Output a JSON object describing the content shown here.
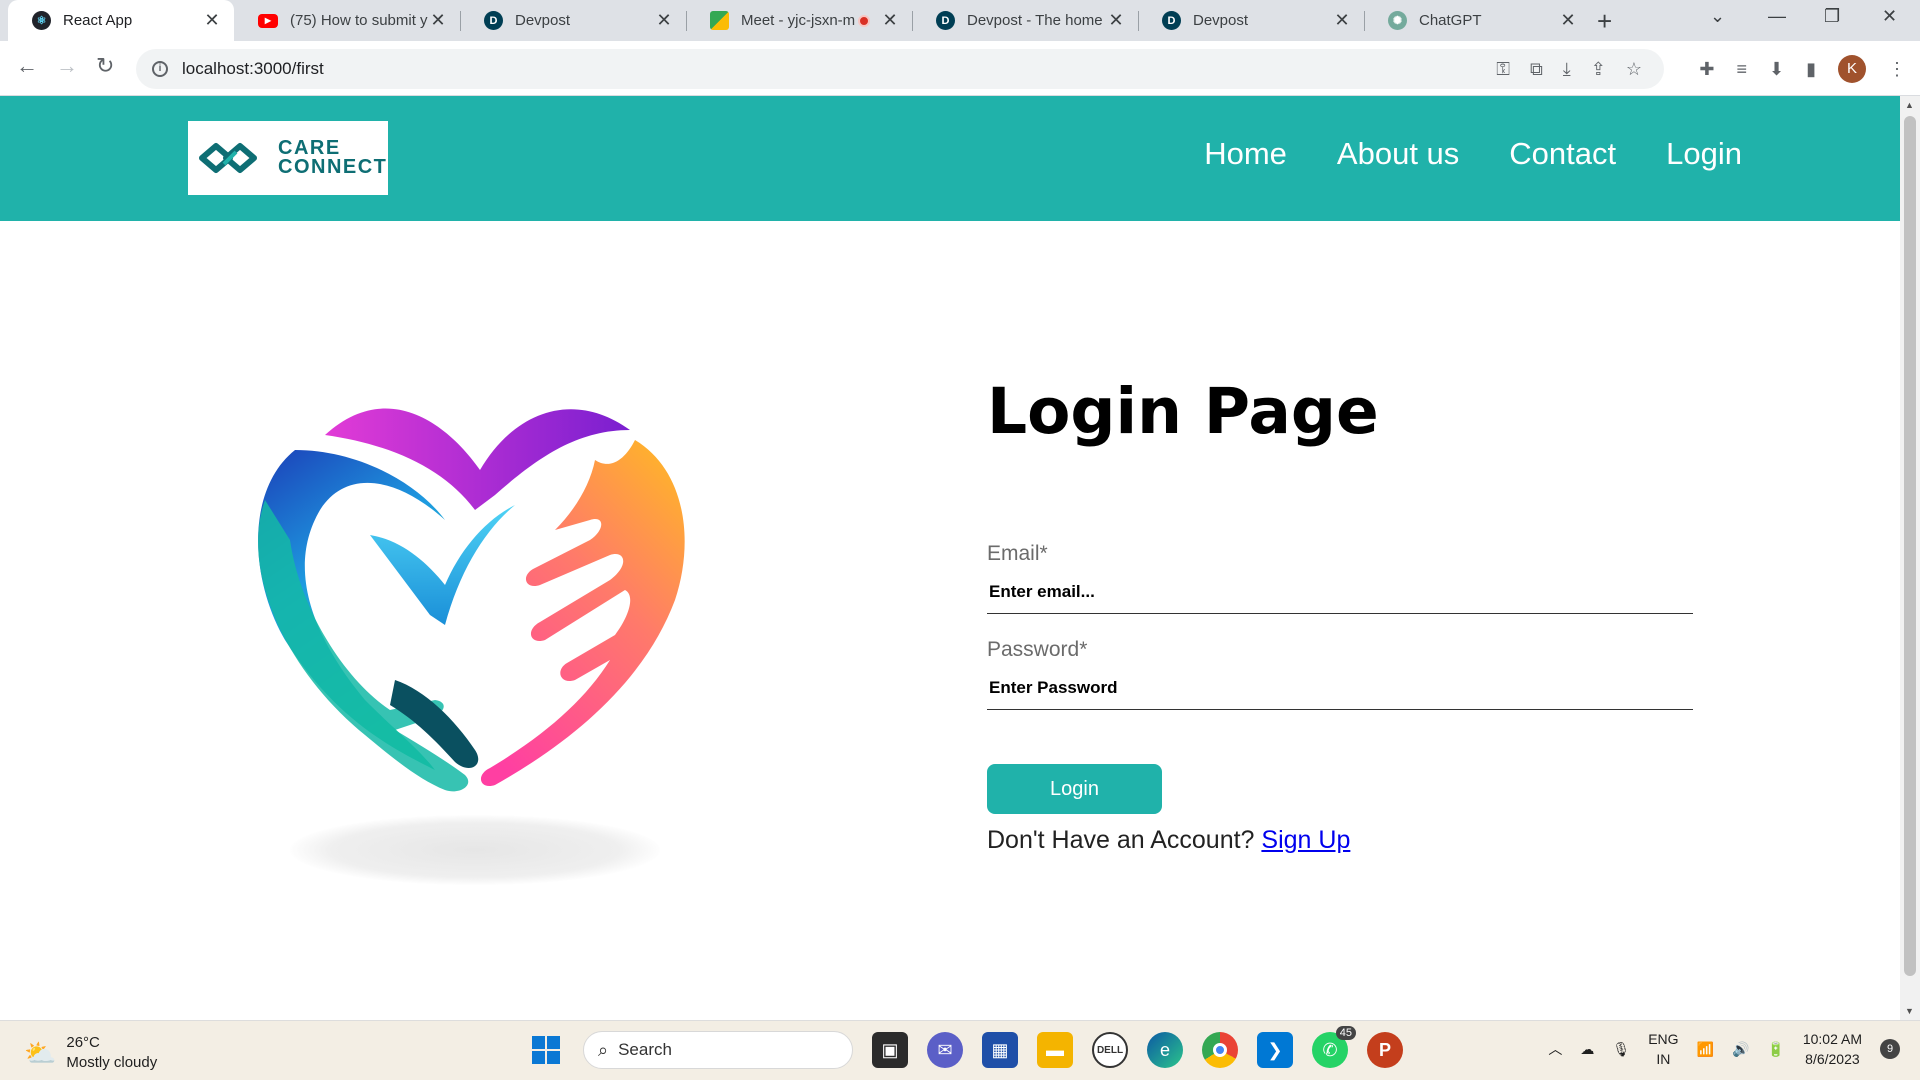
{
  "browser": {
    "tabs": [
      {
        "label": "React App",
        "favicon": "react-icon",
        "active": true
      },
      {
        "label": "(75) How to submit yo",
        "favicon": "youtube-icon"
      },
      {
        "label": "Devpost",
        "favicon": "devpost-icon"
      },
      {
        "label": "Meet - yjc-jsxn-m",
        "favicon": "google-meet-icon",
        "recording": true
      },
      {
        "label": "Devpost - The home f",
        "favicon": "devpost-icon"
      },
      {
        "label": "Devpost",
        "favicon": "devpost-icon"
      },
      {
        "label": "ChatGPT",
        "favicon": "chatgpt-icon"
      }
    ],
    "url": "localhost:3000/first",
    "profile_initial": "K"
  },
  "header": {
    "logo_line1": "CARE",
    "logo_line2": "CONNECT",
    "nav": [
      "Home",
      "About us",
      "Contact",
      "Login"
    ],
    "color": "#20b2aa"
  },
  "login": {
    "title": "Login Page",
    "email_label": "Email*",
    "email_placeholder": "Enter email...",
    "password_label": "Password*",
    "password_placeholder": "Enter Password",
    "button": "Login",
    "signup_prompt": "Don't Have an Account?",
    "signup_link": "Sign Up"
  },
  "taskbar": {
    "temperature": "26°C",
    "weather": "Mostly cloudy",
    "search_label": "Search",
    "whatsapp_badge": "45",
    "language_line1": "ENG",
    "language_line2": "IN",
    "time": "10:02 AM",
    "date": "8/6/2023",
    "notification_count": "9"
  }
}
